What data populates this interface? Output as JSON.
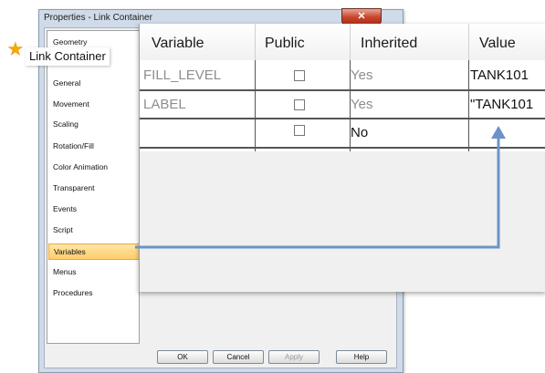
{
  "dialog": {
    "title": "Properties - Link Container",
    "close_label": "✕"
  },
  "callout": {
    "label": "Link Container",
    "icon": "star-icon"
  },
  "sidebar": {
    "items": [
      {
        "label": "Geometry"
      },
      {
        "label": "General"
      },
      {
        "label": "Movement"
      },
      {
        "label": "Scaling"
      },
      {
        "label": "Rotation/Fill"
      },
      {
        "label": "Color Animation"
      },
      {
        "label": "Transparent"
      },
      {
        "label": "Events"
      },
      {
        "label": "Script"
      },
      {
        "label": "Variables",
        "selected": true
      },
      {
        "label": "Menus"
      },
      {
        "label": "Procedures"
      }
    ]
  },
  "buttons": {
    "ok": "OK",
    "cancel": "Cancel",
    "apply": "Apply",
    "help": "Help"
  },
  "table": {
    "headers": {
      "variable": "Variable",
      "public": "Public",
      "inherited": "Inherited",
      "value": "Value"
    },
    "rows": [
      {
        "variable": "FILL_LEVEL",
        "public": false,
        "inherited": "Yes",
        "value": "TANK101"
      },
      {
        "variable": "LABEL",
        "public": false,
        "inherited": "Yes",
        "value": "\"TANK101"
      },
      {
        "variable": "",
        "public": false,
        "inherited": "No",
        "value": ""
      }
    ]
  },
  "colors": {
    "arrow": "#6b93c8",
    "selected": "#ffcc6b",
    "star": "#f2a60c"
  }
}
